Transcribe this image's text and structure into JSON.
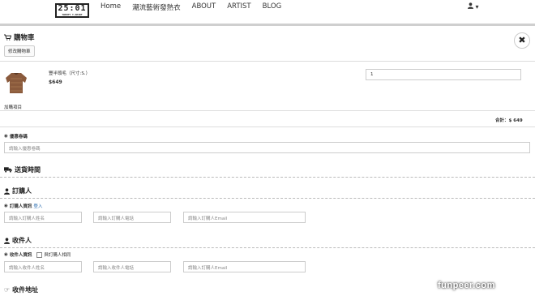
{
  "header": {
    "logo_main": "25:01",
    "logo_sub": "TWENTY T-SHIRT",
    "nav": [
      "Home",
      "潮流藝術發熱衣",
      "ABOUT",
      "ARTIST",
      "BLOG"
    ],
    "user_caret": "▾"
  },
  "cart": {
    "title": "購物車",
    "edit_button": "修改購物車",
    "item_name": "豐半頭毛（尺寸:S.）",
    "item_price": "$649",
    "quantity": "1",
    "addon_label": "加購項目",
    "total_text": "合計：$ 649"
  },
  "coupon": {
    "label": "優惠卷碼",
    "placeholder": "請輸入優惠卷碼"
  },
  "shipping": {
    "title": "送貨時間"
  },
  "buyer": {
    "title": "訂購人",
    "info_label": "訂購人資訊",
    "login_link": "登入",
    "name_placeholder": "請輸入訂購人姓名",
    "phone_placeholder": "請輸入訂購人電話",
    "email_placeholder": "請輸入訂購人Email"
  },
  "recipient": {
    "title": "收件人",
    "info_label": "收件人資訊",
    "same_as_buyer": "與訂購人相同",
    "name_placeholder": "請輸入收件人姓名",
    "phone_placeholder": "請輸入收件人電話",
    "email_placeholder": "請輸入訂購人Email"
  },
  "address": {
    "title": "收件地址"
  },
  "watermark": "funpeer.com"
}
